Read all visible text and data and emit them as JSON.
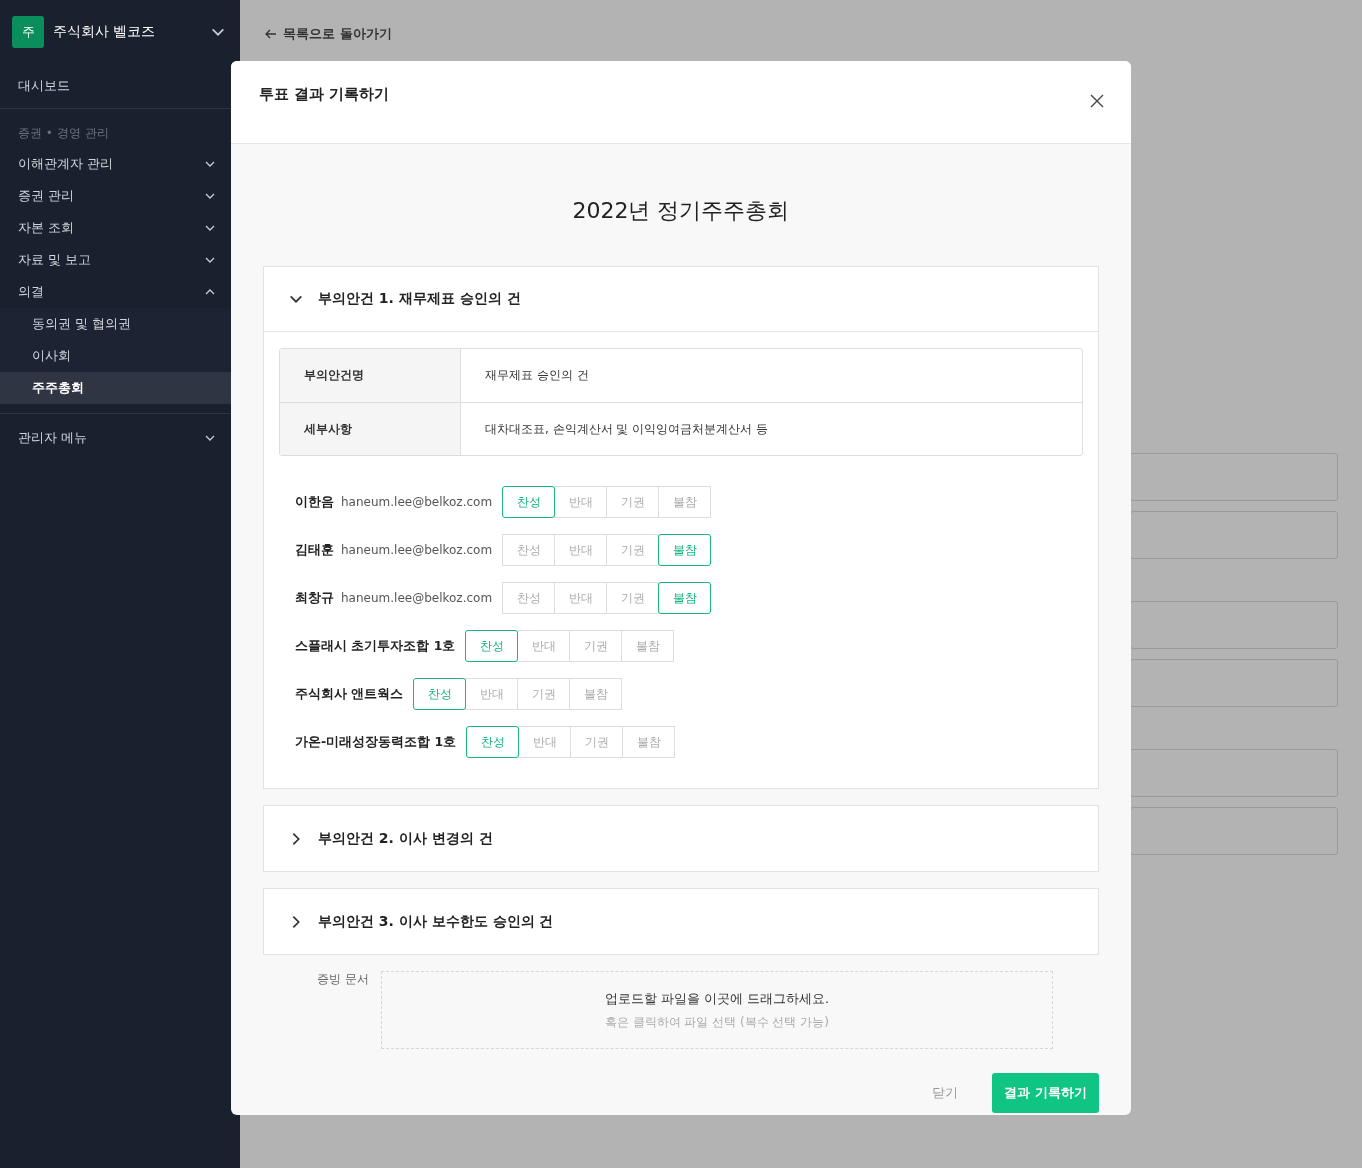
{
  "sidebar": {
    "company": {
      "badge": "주",
      "name": "주식회사 벨코즈"
    },
    "top_item": {
      "label": "대시보드"
    },
    "section_label": "증권 • 경영 관리",
    "items": [
      {
        "label": "이해관계자 관리",
        "expanded": false
      },
      {
        "label": "증권 관리",
        "expanded": false
      },
      {
        "label": "자본 조회",
        "expanded": false
      },
      {
        "label": "자료 및 보고",
        "expanded": false
      },
      {
        "label": "의결",
        "expanded": true,
        "children": [
          {
            "label": "동의권 및 협의권",
            "selected": false
          },
          {
            "label": "이사회",
            "selected": false
          },
          {
            "label": "주주총회",
            "selected": true
          }
        ]
      }
    ],
    "admin_item": {
      "label": "관리자 메뉴",
      "expanded": false
    }
  },
  "back_link": "목록으로 돌아가기",
  "modal": {
    "title": "투표 결과 기록하기",
    "meeting_title": "2022년 정기주주총회",
    "agenda": [
      {
        "title": "부의안건 1. 재무제표 승인의 건",
        "expanded": true,
        "details": [
          {
            "label": "부의안건명",
            "value": "재무제표 승인의 건"
          },
          {
            "label": "세부사항",
            "value": "대차대조표, 손익계산서 및 이익잉여금처분계산서 등"
          }
        ],
        "voters": [
          {
            "name": "이한음",
            "email": "haneum.lee@belkoz.com",
            "options": [
              {
                "label": "찬성",
                "selected": true
              },
              {
                "label": "반대",
                "selected": false
              },
              {
                "label": "기권",
                "selected": false
              },
              {
                "label": "불참",
                "selected": false
              }
            ]
          },
          {
            "name": "김태훈",
            "email": "haneum.lee@belkoz.com",
            "options": [
              {
                "label": "찬성",
                "selected": false
              },
              {
                "label": "반대",
                "selected": false
              },
              {
                "label": "기권",
                "selected": false
              },
              {
                "label": "불참",
                "selected": true
              }
            ]
          },
          {
            "name": "최창규",
            "email": "haneum.lee@belkoz.com",
            "options": [
              {
                "label": "찬성",
                "selected": false
              },
              {
                "label": "반대",
                "selected": false
              },
              {
                "label": "기권",
                "selected": false
              },
              {
                "label": "불참",
                "selected": true
              }
            ]
          },
          {
            "name": "스플래시 초기투자조합 1호",
            "options": [
              {
                "label": "찬성",
                "selected": true
              },
              {
                "label": "반대",
                "selected": false
              },
              {
                "label": "기권",
                "selected": false
              },
              {
                "label": "불참",
                "selected": false
              }
            ]
          },
          {
            "name": "주식회사 앤트웍스",
            "options": [
              {
                "label": "찬성",
                "selected": true
              },
              {
                "label": "반대",
                "selected": false
              },
              {
                "label": "기권",
                "selected": false
              },
              {
                "label": "불참",
                "selected": false
              }
            ]
          },
          {
            "name": "가온-미래성장동력조합 1호",
            "options": [
              {
                "label": "찬성",
                "selected": true
              },
              {
                "label": "반대",
                "selected": false
              },
              {
                "label": "기권",
                "selected": false
              },
              {
                "label": "불참",
                "selected": false
              }
            ]
          }
        ]
      },
      {
        "title": "부의안건 2. 이사 변경의 건",
        "expanded": false
      },
      {
        "title": "부의안건 3. 이사 보수한도 승인의 건",
        "expanded": false
      }
    ],
    "upload": {
      "label": "증빙 문서",
      "main_text": "업로드할 파일을 이곳에 드래그하세요.",
      "sub_text": "혹은 클릭하여 파일 선택 (복수 선택 가능)"
    },
    "buttons": {
      "close": "닫기",
      "submit": "결과 기록하기"
    }
  }
}
